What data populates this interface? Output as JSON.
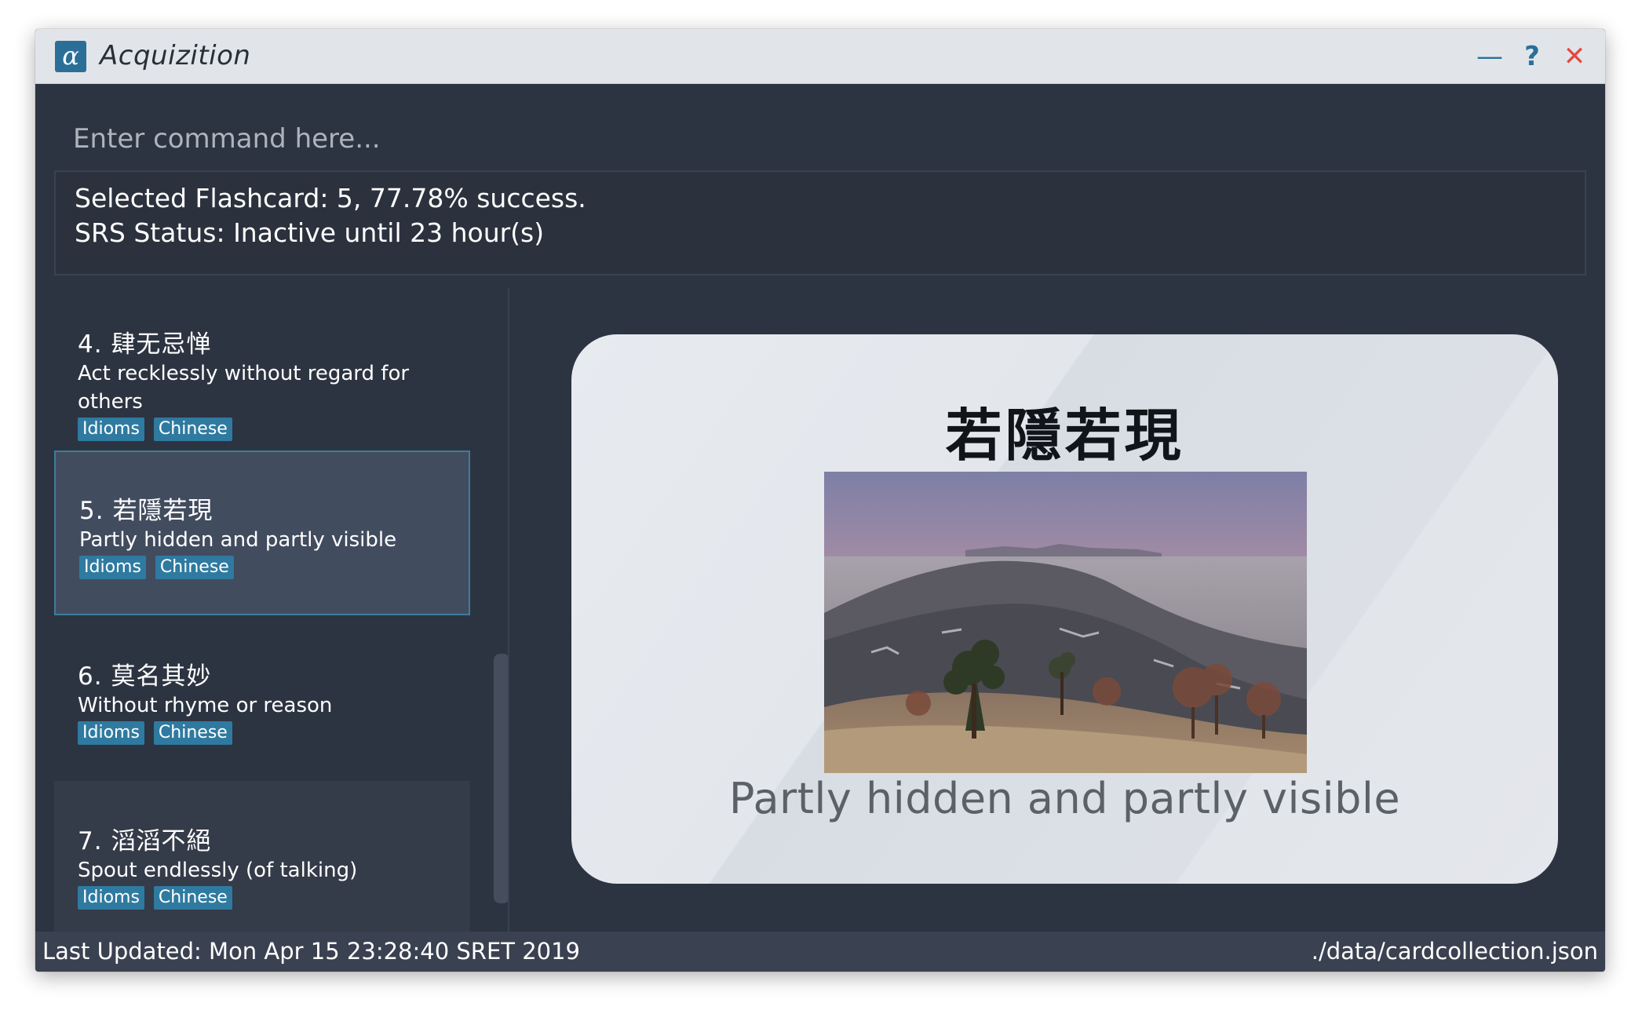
{
  "window": {
    "title": "Acquizition",
    "icon_glyph": "α",
    "controls": {
      "minimize": "—",
      "help": "?",
      "close": "✕"
    }
  },
  "command": {
    "placeholder": "Enter command here...",
    "value": ""
  },
  "result": {
    "line1": "Selected Flashcard: 5, 77.78% success.",
    "line2": "SRS Status: Inactive until 23 hour(s)"
  },
  "cards": [
    {
      "index": "4.",
      "title": "肆无忌惮",
      "description": "Act recklessly without regard for others",
      "tags": [
        "Idioms",
        "Chinese"
      ]
    },
    {
      "index": "5.",
      "title": "若隱若現",
      "description": "Partly hidden and partly visible",
      "tags": [
        "Idioms",
        "Chinese"
      ]
    },
    {
      "index": "6.",
      "title": "莫名其妙",
      "description": "Without rhyme or reason",
      "tags": [
        "Idioms",
        "Chinese"
      ]
    },
    {
      "index": "7.",
      "title": "滔滔不絕",
      "description": "Spout endlessly (of talking)",
      "tags": [
        "Idioms",
        "Chinese"
      ]
    }
  ],
  "flashcard": {
    "question": "若隱若現",
    "answer": "Partly hidden and partly visible",
    "image_subject": "misty-mountain-landscape"
  },
  "status": {
    "last_updated": "Last Updated: Mon Apr 15 23:28:40 SRET 2019",
    "file_path": "./data/cardcollection.json"
  },
  "colors": {
    "background": "#2d3441",
    "titlebar": "#e1e5ea",
    "accent": "#2b6f98",
    "tag": "#2f7aa0",
    "close": "#e04a3f",
    "selected_row": "#424c5f",
    "flashcard": "#e4e7ec"
  }
}
